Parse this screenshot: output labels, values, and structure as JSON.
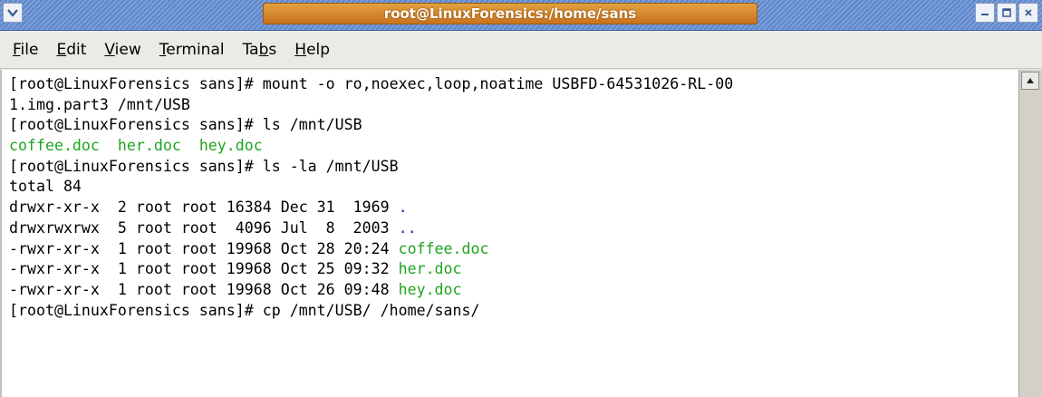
{
  "window": {
    "title": "root@LinuxForensics:/home/sans",
    "menu_icon": "chevron-down-icon",
    "controls": [
      "minimize-icon",
      "maximize-icon",
      "close-icon"
    ]
  },
  "menubar": {
    "items": [
      {
        "label": "File",
        "mnemonic": "F"
      },
      {
        "label": "Edit",
        "mnemonic": "E"
      },
      {
        "label": "View",
        "mnemonic": "V"
      },
      {
        "label": "Terminal",
        "mnemonic": "T"
      },
      {
        "label": "Tabs",
        "mnemonic": "b"
      },
      {
        "label": "Help",
        "mnemonic": "H"
      }
    ]
  },
  "terminal": {
    "colors": {
      "text": "#000000",
      "file": "#1fa51f",
      "dir": "#1a2fa8"
    },
    "lines": [
      {
        "text": "[root@LinuxForensics sans]# mount -o ro,noexec,loop,noatime USBFD-64531026-RL-00"
      },
      {
        "text": "1.img.part3 /mnt/USB"
      },
      {
        "text": "[root@LinuxForensics sans]# ls /mnt/USB"
      },
      {
        "text": "coffee.doc  her.doc  hey.doc"
      },
      {
        "text": "[root@LinuxForensics sans]# ls -la /mnt/USB"
      },
      {
        "text": "total 84"
      },
      {
        "text": "drwxr-xr-x  2 root root 16384 Dec 31  1969 ",
        "name": "."
      },
      {
        "text": "drwxrwxrwx  5 root root  4096 Jul  8  2003 ",
        "name": ".."
      },
      {
        "text": "-rwxr-xr-x  1 root root 19968 Oct 28 20:24 ",
        "name": "coffee.doc"
      },
      {
        "text": "-rwxr-xr-x  1 root root 19968 Oct 25 09:32 ",
        "name": "her.doc"
      },
      {
        "text": "-rwxr-xr-x  1 root root 19968 Oct 26 09:48 ",
        "name": "hey.doc"
      },
      {
        "text": "[root@LinuxForensics sans]# cp /mnt/USB/ /home/sans/"
      }
    ]
  },
  "scrollbar": {
    "up_icon": "arrow-up-icon"
  }
}
